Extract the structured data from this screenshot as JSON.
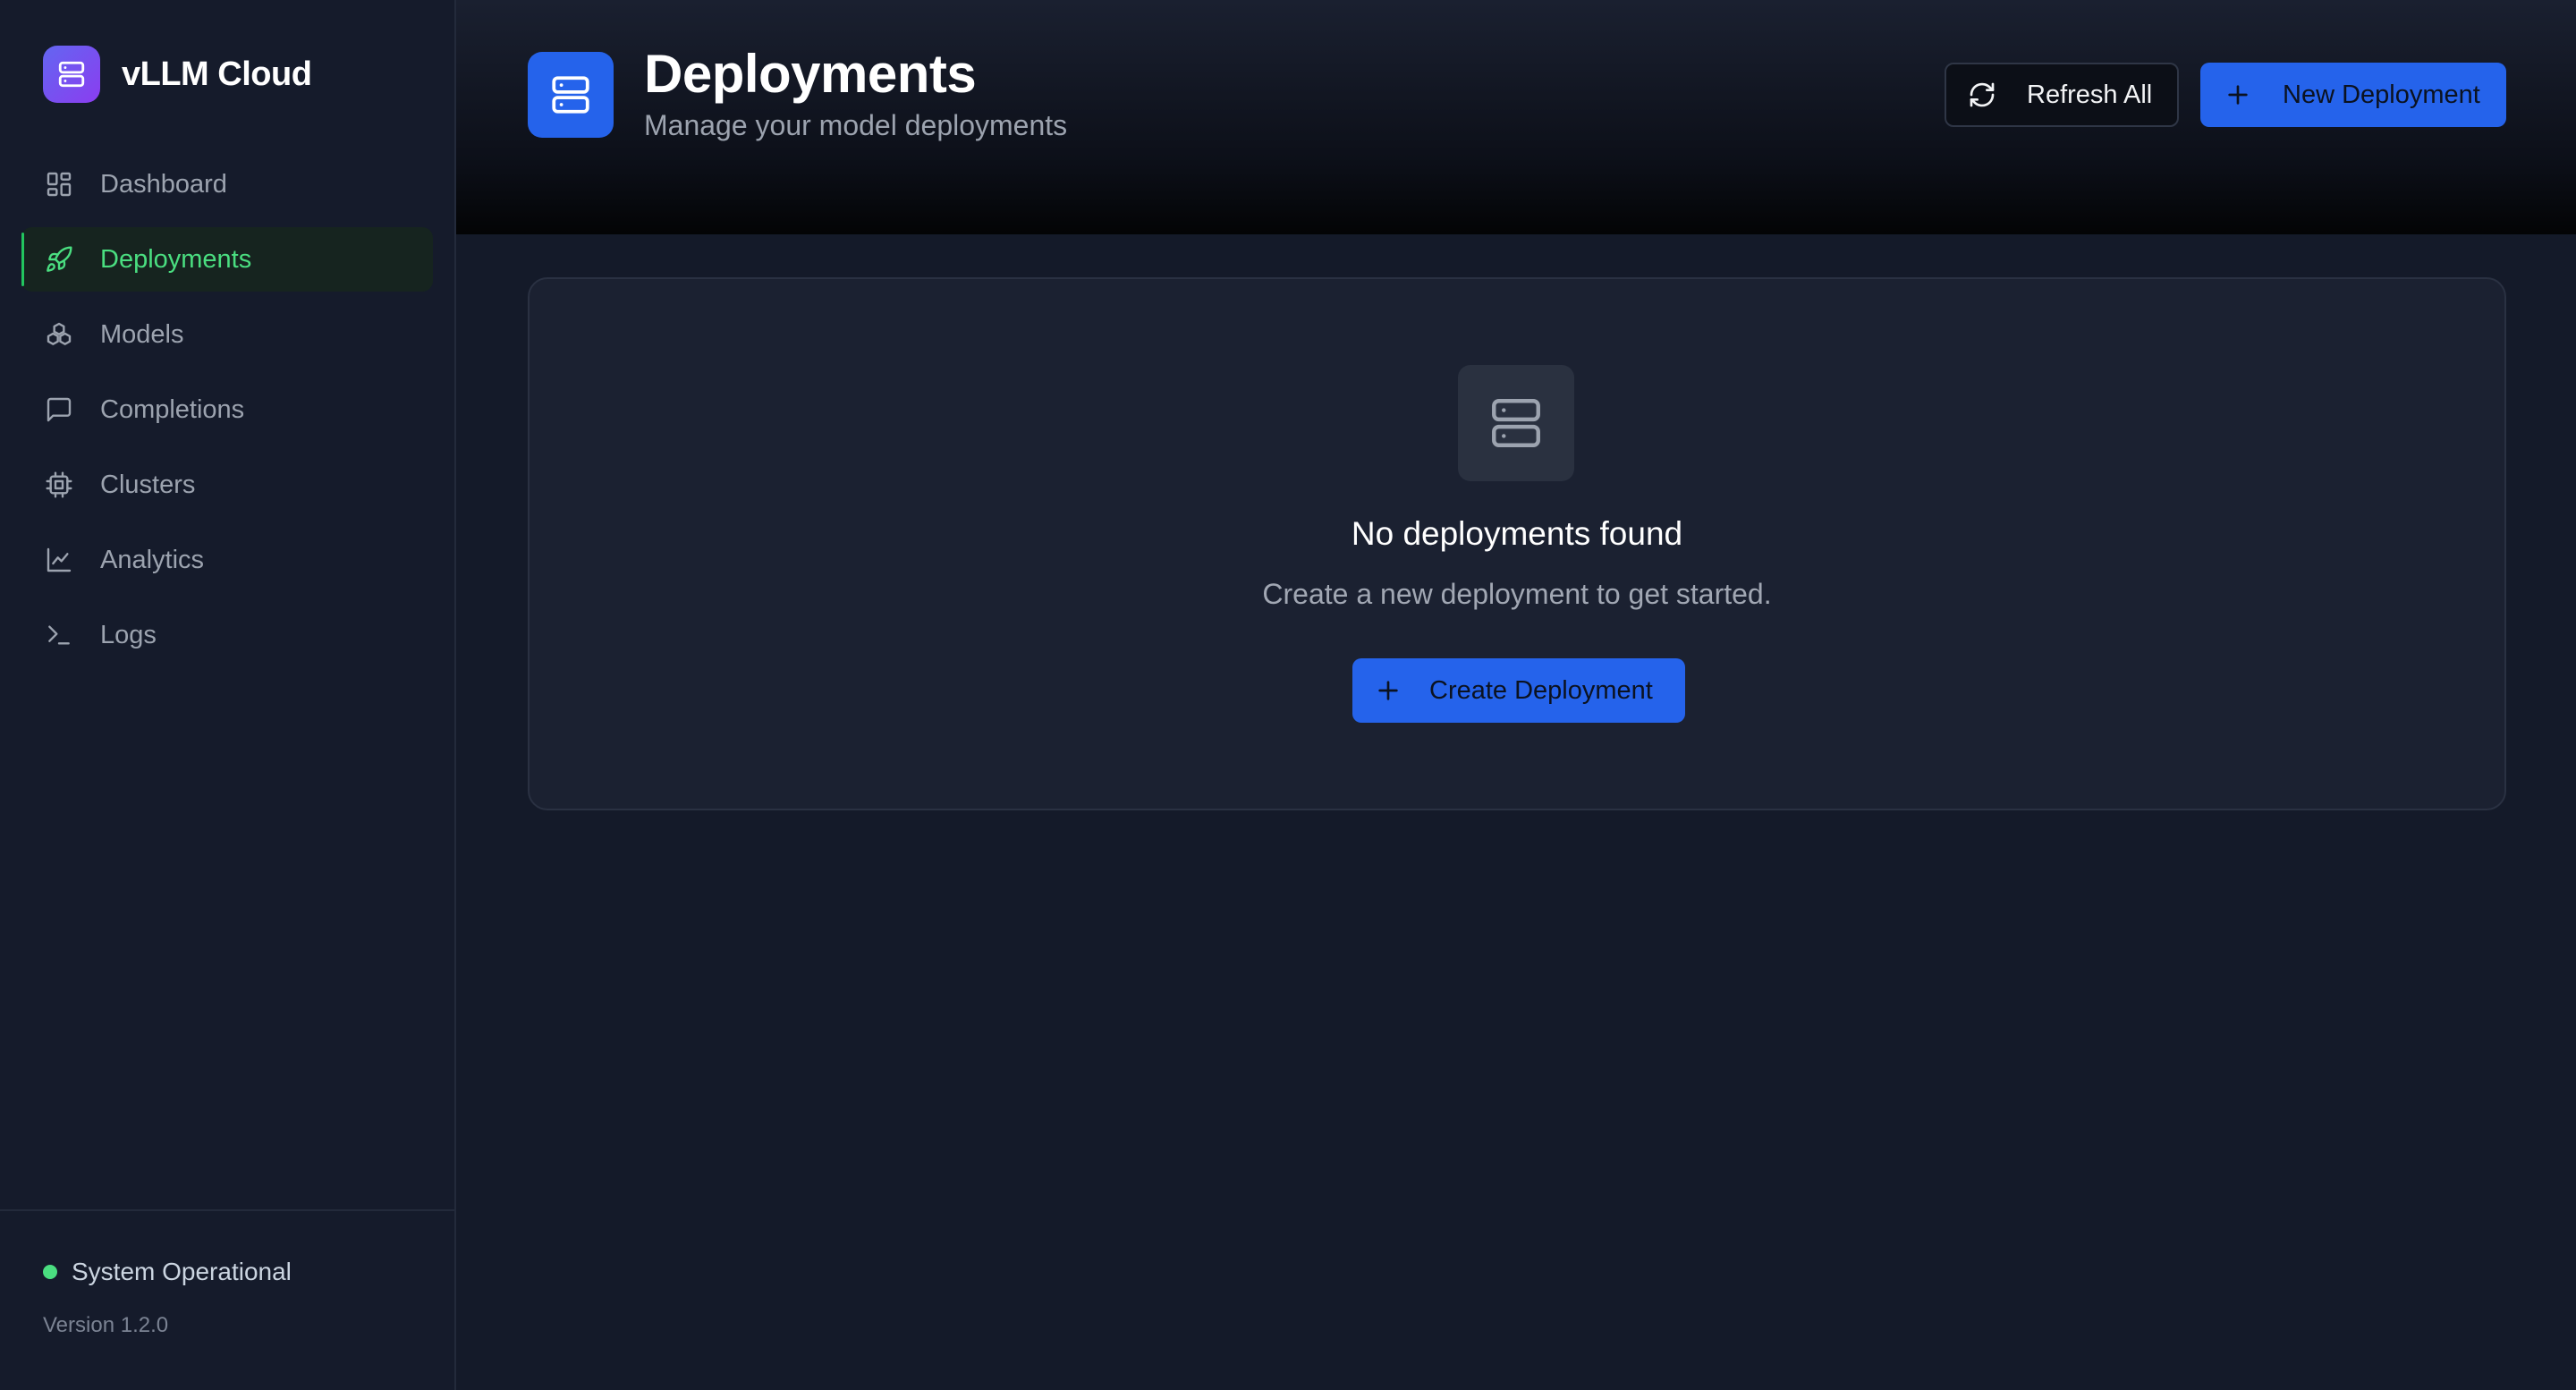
{
  "brand": {
    "name": "vLLM Cloud",
    "icon": "server-icon"
  },
  "sidebar": {
    "items": [
      {
        "label": "Dashboard",
        "icon": "dashboard-icon",
        "active": false
      },
      {
        "label": "Deployments",
        "icon": "rocket-icon",
        "active": true
      },
      {
        "label": "Models",
        "icon": "boxes-icon",
        "active": false
      },
      {
        "label": "Completions",
        "icon": "message-square-icon",
        "active": false
      },
      {
        "label": "Clusters",
        "icon": "cpu-icon",
        "active": false
      },
      {
        "label": "Analytics",
        "icon": "line-chart-icon",
        "active": false
      },
      {
        "label": "Logs",
        "icon": "terminal-icon",
        "active": false
      }
    ],
    "footer": {
      "status": "System Operational",
      "status_color": "#4ade80",
      "version": "Version 1.2.0"
    }
  },
  "header": {
    "title": "Deployments",
    "subtitle": "Manage your model deployments",
    "refresh_label": "Refresh All",
    "new_label": "New Deployment"
  },
  "empty_state": {
    "title": "No deployments found",
    "description": "Create a new deployment to get started.",
    "button_label": "Create Deployment"
  },
  "colors": {
    "accent": "#2563eb",
    "active_nav": "#4ade80",
    "brand_gradient": [
      "#6366f1",
      "#8b3df0"
    ]
  }
}
